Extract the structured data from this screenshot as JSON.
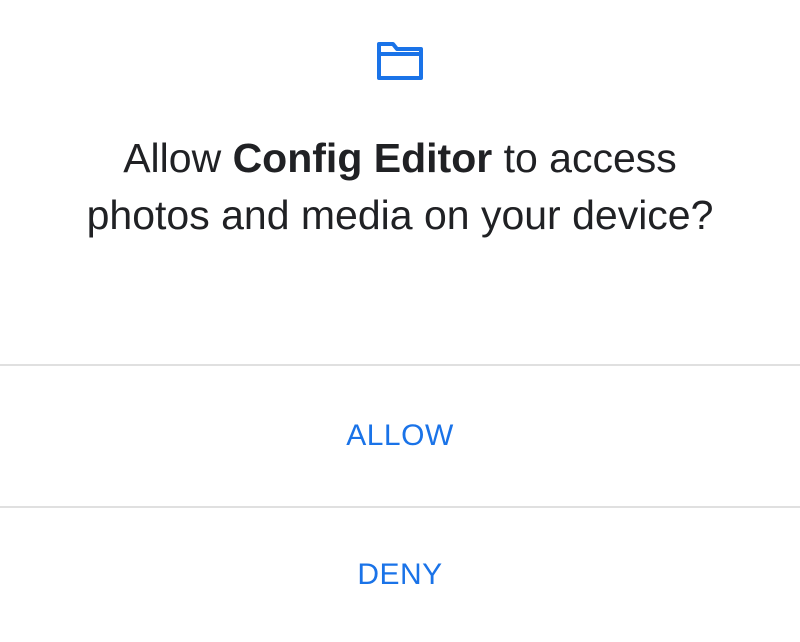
{
  "permission_dialog": {
    "icon": "folder-icon",
    "message_prefix": "Allow ",
    "app_name": "Config Editor",
    "message_suffix": " to access photos and media on your device?",
    "allow_label": "ALLOW",
    "deny_label": "DENY"
  },
  "colors": {
    "accent": "#1a73e8",
    "text": "#202124",
    "divider": "#e0e0e0",
    "background": "#ffffff"
  }
}
